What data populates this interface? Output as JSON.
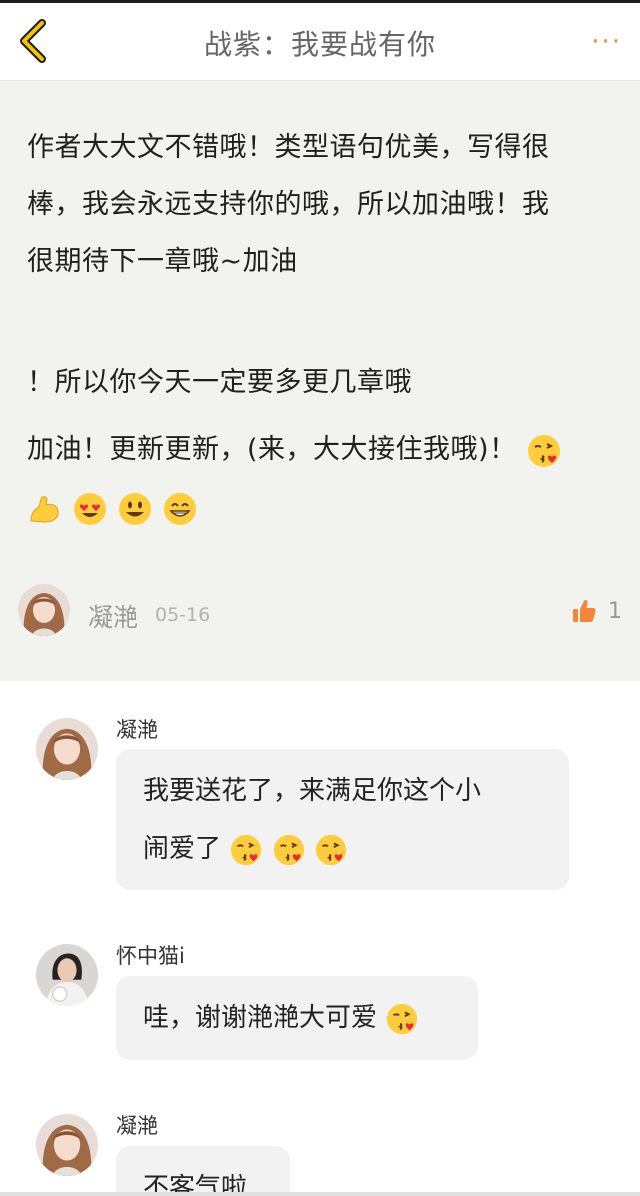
{
  "header": {
    "title": "战紫：我要战有你",
    "back_icon": "chevron-left-icon",
    "more_icon": "more-dots-icon",
    "more_label": "···",
    "accent_color": "#f3863b"
  },
  "post": {
    "lines": [
      "作者大大文不错哦！类型语句优美，写得很",
      "棒，我会永远支持你的哦，所以加油哦！我",
      "很期待下一章哦~加油"
    ],
    "line2": "！所以你今天一定要多更几章哦",
    "line3": "加油！更新更新，(来，大大接住我哦)！",
    "author": "凝滟",
    "date": "05-16",
    "likes": "1"
  },
  "replies": [
    {
      "name": "凝滟",
      "text_lines": [
        "我要送花了，来满足你这个小",
        "闹爱了"
      ]
    },
    {
      "name": "怀中猫i",
      "text_lines": [
        "哇，谢谢滟滟大可爱"
      ]
    },
    {
      "name": "凝滟",
      "text_lines": [
        "不客气啦"
      ]
    }
  ]
}
